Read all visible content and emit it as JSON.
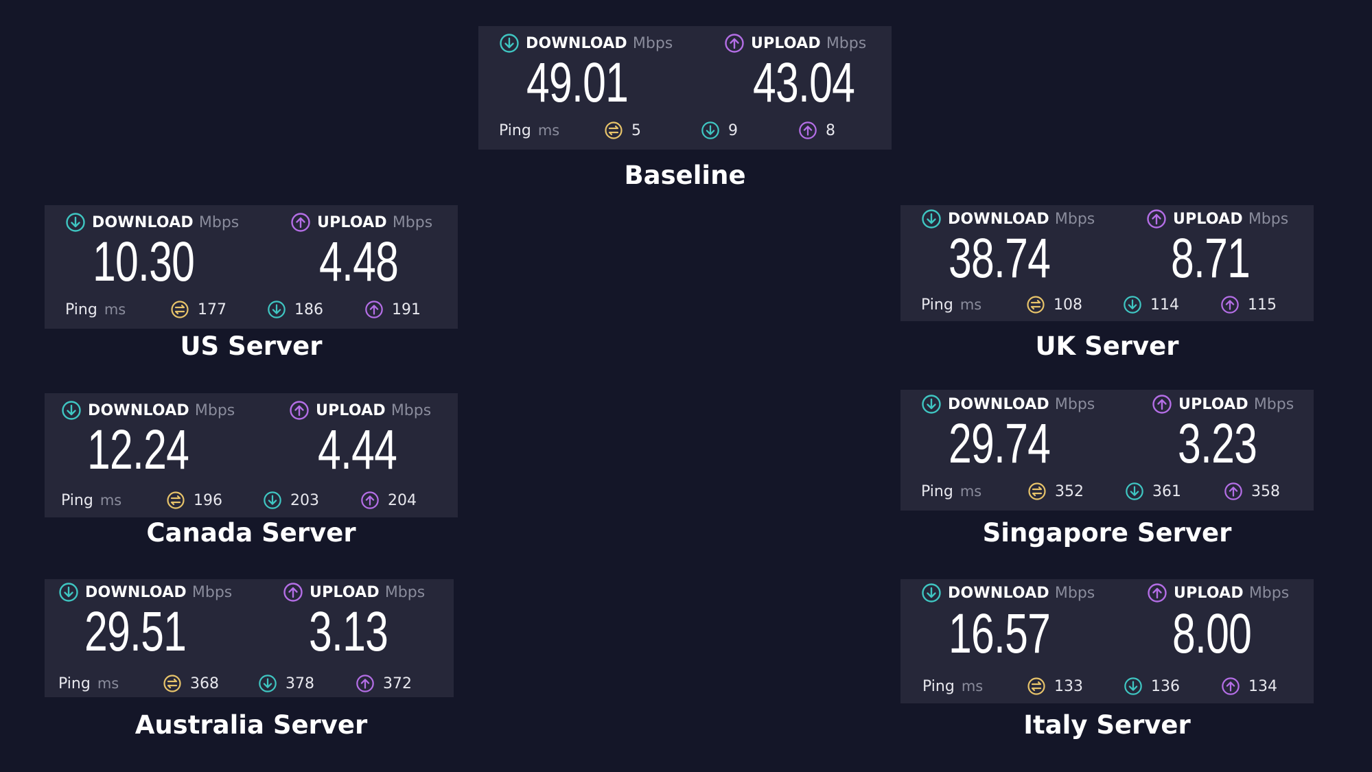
{
  "labels": {
    "download": "DOWNLOAD",
    "upload": "UPLOAD",
    "mbps": "Mbps",
    "ping": "Ping",
    "ms": "ms"
  },
  "colors": {
    "background": "#141628",
    "card": "#262739",
    "download_icon": "#3fc6c2",
    "upload_icon": "#b46ee6",
    "jitter_icon": "#e8c46a"
  },
  "icons": {
    "download": "download-arrow-circle-icon",
    "upload": "upload-arrow-circle-icon",
    "idle_ping": "idle-latency-icon"
  },
  "results": {
    "baseline": {
      "title": "Baseline",
      "download": "49.01",
      "upload": "43.04",
      "ping_idle": "5",
      "ping_download": "9",
      "ping_upload": "8"
    },
    "us": {
      "title": "US Server",
      "download": "10.30",
      "upload": "4.48",
      "ping_idle": "177",
      "ping_download": "186",
      "ping_upload": "191"
    },
    "uk": {
      "title": "UK Server",
      "download": "38.74",
      "upload": "8.71",
      "ping_idle": "108",
      "ping_download": "114",
      "ping_upload": "115"
    },
    "canada": {
      "title": "Canada Server",
      "download": "12.24",
      "upload": "4.44",
      "ping_idle": "196",
      "ping_download": "203",
      "ping_upload": "204"
    },
    "singapore": {
      "title": "Singapore Server",
      "download": "29.74",
      "upload": "3.23",
      "ping_idle": "352",
      "ping_download": "361",
      "ping_upload": "358"
    },
    "australia": {
      "title": "Australia Server",
      "download": "29.51",
      "upload": "3.13",
      "ping_idle": "368",
      "ping_download": "378",
      "ping_upload": "372"
    },
    "italy": {
      "title": "Italy Server",
      "download": "16.57",
      "upload": "8.00",
      "ping_idle": "133",
      "ping_download": "136",
      "ping_upload": "134"
    }
  }
}
